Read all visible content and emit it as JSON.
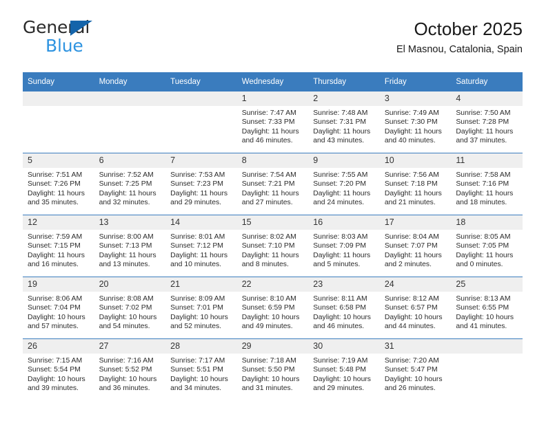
{
  "brand": {
    "name_top": "General",
    "name_bottom": "Blue",
    "triangle_color": "#1464aa",
    "blue_text_color": "#2e93e0"
  },
  "header": {
    "title": "October 2025",
    "subtitle": "El Masnou, Catalonia, Spain"
  },
  "theme": {
    "header_blue": "#3a7cbe",
    "daynum_background": "#efefef",
    "row_border": "#3a7cbe",
    "text": "#1a1a1a"
  },
  "calendar": {
    "weekday_headers": [
      "Sunday",
      "Monday",
      "Tuesday",
      "Wednesday",
      "Thursday",
      "Friday",
      "Saturday"
    ],
    "weeks": [
      [
        {
          "day": "",
          "sunrise": "",
          "sunset": "",
          "daylight_1": "",
          "daylight_2": ""
        },
        {
          "day": "",
          "sunrise": "",
          "sunset": "",
          "daylight_1": "",
          "daylight_2": ""
        },
        {
          "day": "",
          "sunrise": "",
          "sunset": "",
          "daylight_1": "",
          "daylight_2": ""
        },
        {
          "day": "1",
          "sunrise": "Sunrise: 7:47 AM",
          "sunset": "Sunset: 7:33 PM",
          "daylight_1": "Daylight: 11 hours",
          "daylight_2": "and 46 minutes."
        },
        {
          "day": "2",
          "sunrise": "Sunrise: 7:48 AM",
          "sunset": "Sunset: 7:31 PM",
          "daylight_1": "Daylight: 11 hours",
          "daylight_2": "and 43 minutes."
        },
        {
          "day": "3",
          "sunrise": "Sunrise: 7:49 AM",
          "sunset": "Sunset: 7:30 PM",
          "daylight_1": "Daylight: 11 hours",
          "daylight_2": "and 40 minutes."
        },
        {
          "day": "4",
          "sunrise": "Sunrise: 7:50 AM",
          "sunset": "Sunset: 7:28 PM",
          "daylight_1": "Daylight: 11 hours",
          "daylight_2": "and 37 minutes."
        }
      ],
      [
        {
          "day": "5",
          "sunrise": "Sunrise: 7:51 AM",
          "sunset": "Sunset: 7:26 PM",
          "daylight_1": "Daylight: 11 hours",
          "daylight_2": "and 35 minutes."
        },
        {
          "day": "6",
          "sunrise": "Sunrise: 7:52 AM",
          "sunset": "Sunset: 7:25 PM",
          "daylight_1": "Daylight: 11 hours",
          "daylight_2": "and 32 minutes."
        },
        {
          "day": "7",
          "sunrise": "Sunrise: 7:53 AM",
          "sunset": "Sunset: 7:23 PM",
          "daylight_1": "Daylight: 11 hours",
          "daylight_2": "and 29 minutes."
        },
        {
          "day": "8",
          "sunrise": "Sunrise: 7:54 AM",
          "sunset": "Sunset: 7:21 PM",
          "daylight_1": "Daylight: 11 hours",
          "daylight_2": "and 27 minutes."
        },
        {
          "day": "9",
          "sunrise": "Sunrise: 7:55 AM",
          "sunset": "Sunset: 7:20 PM",
          "daylight_1": "Daylight: 11 hours",
          "daylight_2": "and 24 minutes."
        },
        {
          "day": "10",
          "sunrise": "Sunrise: 7:56 AM",
          "sunset": "Sunset: 7:18 PM",
          "daylight_1": "Daylight: 11 hours",
          "daylight_2": "and 21 minutes."
        },
        {
          "day": "11",
          "sunrise": "Sunrise: 7:58 AM",
          "sunset": "Sunset: 7:16 PM",
          "daylight_1": "Daylight: 11 hours",
          "daylight_2": "and 18 minutes."
        }
      ],
      [
        {
          "day": "12",
          "sunrise": "Sunrise: 7:59 AM",
          "sunset": "Sunset: 7:15 PM",
          "daylight_1": "Daylight: 11 hours",
          "daylight_2": "and 16 minutes."
        },
        {
          "day": "13",
          "sunrise": "Sunrise: 8:00 AM",
          "sunset": "Sunset: 7:13 PM",
          "daylight_1": "Daylight: 11 hours",
          "daylight_2": "and 13 minutes."
        },
        {
          "day": "14",
          "sunrise": "Sunrise: 8:01 AM",
          "sunset": "Sunset: 7:12 PM",
          "daylight_1": "Daylight: 11 hours",
          "daylight_2": "and 10 minutes."
        },
        {
          "day": "15",
          "sunrise": "Sunrise: 8:02 AM",
          "sunset": "Sunset: 7:10 PM",
          "daylight_1": "Daylight: 11 hours",
          "daylight_2": "and 8 minutes."
        },
        {
          "day": "16",
          "sunrise": "Sunrise: 8:03 AM",
          "sunset": "Sunset: 7:09 PM",
          "daylight_1": "Daylight: 11 hours",
          "daylight_2": "and 5 minutes."
        },
        {
          "day": "17",
          "sunrise": "Sunrise: 8:04 AM",
          "sunset": "Sunset: 7:07 PM",
          "daylight_1": "Daylight: 11 hours",
          "daylight_2": "and 2 minutes."
        },
        {
          "day": "18",
          "sunrise": "Sunrise: 8:05 AM",
          "sunset": "Sunset: 7:05 PM",
          "daylight_1": "Daylight: 11 hours",
          "daylight_2": "and 0 minutes."
        }
      ],
      [
        {
          "day": "19",
          "sunrise": "Sunrise: 8:06 AM",
          "sunset": "Sunset: 7:04 PM",
          "daylight_1": "Daylight: 10 hours",
          "daylight_2": "and 57 minutes."
        },
        {
          "day": "20",
          "sunrise": "Sunrise: 8:08 AM",
          "sunset": "Sunset: 7:02 PM",
          "daylight_1": "Daylight: 10 hours",
          "daylight_2": "and 54 minutes."
        },
        {
          "day": "21",
          "sunrise": "Sunrise: 8:09 AM",
          "sunset": "Sunset: 7:01 PM",
          "daylight_1": "Daylight: 10 hours",
          "daylight_2": "and 52 minutes."
        },
        {
          "day": "22",
          "sunrise": "Sunrise: 8:10 AM",
          "sunset": "Sunset: 6:59 PM",
          "daylight_1": "Daylight: 10 hours",
          "daylight_2": "and 49 minutes."
        },
        {
          "day": "23",
          "sunrise": "Sunrise: 8:11 AM",
          "sunset": "Sunset: 6:58 PM",
          "daylight_1": "Daylight: 10 hours",
          "daylight_2": "and 46 minutes."
        },
        {
          "day": "24",
          "sunrise": "Sunrise: 8:12 AM",
          "sunset": "Sunset: 6:57 PM",
          "daylight_1": "Daylight: 10 hours",
          "daylight_2": "and 44 minutes."
        },
        {
          "day": "25",
          "sunrise": "Sunrise: 8:13 AM",
          "sunset": "Sunset: 6:55 PM",
          "daylight_1": "Daylight: 10 hours",
          "daylight_2": "and 41 minutes."
        }
      ],
      [
        {
          "day": "26",
          "sunrise": "Sunrise: 7:15 AM",
          "sunset": "Sunset: 5:54 PM",
          "daylight_1": "Daylight: 10 hours",
          "daylight_2": "and 39 minutes."
        },
        {
          "day": "27",
          "sunrise": "Sunrise: 7:16 AM",
          "sunset": "Sunset: 5:52 PM",
          "daylight_1": "Daylight: 10 hours",
          "daylight_2": "and 36 minutes."
        },
        {
          "day": "28",
          "sunrise": "Sunrise: 7:17 AM",
          "sunset": "Sunset: 5:51 PM",
          "daylight_1": "Daylight: 10 hours",
          "daylight_2": "and 34 minutes."
        },
        {
          "day": "29",
          "sunrise": "Sunrise: 7:18 AM",
          "sunset": "Sunset: 5:50 PM",
          "daylight_1": "Daylight: 10 hours",
          "daylight_2": "and 31 minutes."
        },
        {
          "day": "30",
          "sunrise": "Sunrise: 7:19 AM",
          "sunset": "Sunset: 5:48 PM",
          "daylight_1": "Daylight: 10 hours",
          "daylight_2": "and 29 minutes."
        },
        {
          "day": "31",
          "sunrise": "Sunrise: 7:20 AM",
          "sunset": "Sunset: 5:47 PM",
          "daylight_1": "Daylight: 10 hours",
          "daylight_2": "and 26 minutes."
        },
        {
          "day": "",
          "sunrise": "",
          "sunset": "",
          "daylight_1": "",
          "daylight_2": ""
        }
      ]
    ]
  }
}
